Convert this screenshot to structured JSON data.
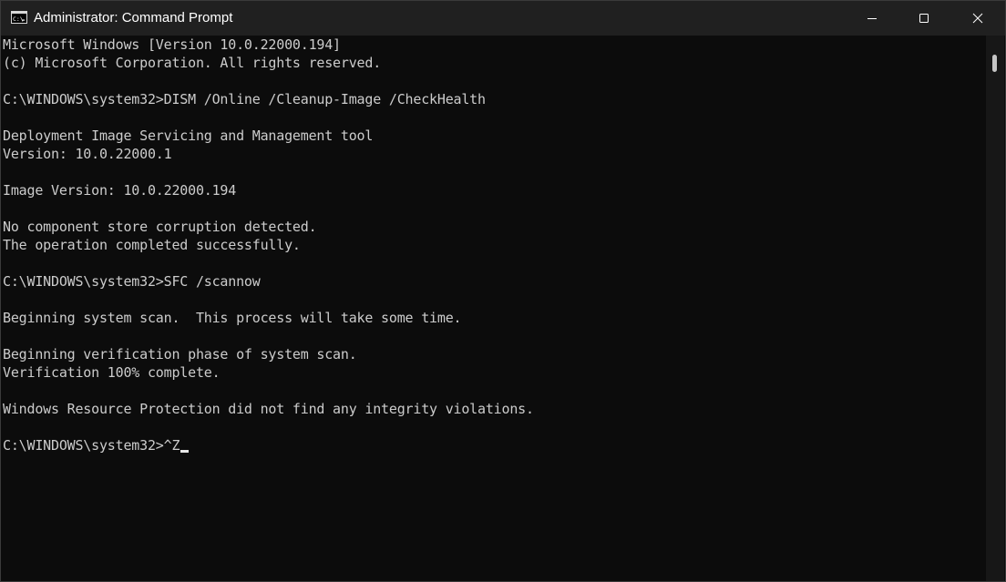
{
  "window": {
    "title": "Administrator: Command Prompt",
    "icon": "cmd-icon",
    "controls": {
      "minimize": "minimize-icon",
      "maximize": "maximize-icon",
      "close": "close-icon"
    }
  },
  "console": {
    "lines": [
      "Microsoft Windows [Version 10.0.22000.194]",
      "(c) Microsoft Corporation. All rights reserved.",
      "",
      "C:\\WINDOWS\\system32>DISM /Online /Cleanup-Image /CheckHealth",
      "",
      "Deployment Image Servicing and Management tool",
      "Version: 10.0.22000.1",
      "",
      "Image Version: 10.0.22000.194",
      "",
      "No component store corruption detected.",
      "The operation completed successfully.",
      "",
      "C:\\WINDOWS\\system32>SFC /scannow",
      "",
      "Beginning system scan.  This process will take some time.",
      "",
      "Beginning verification phase of system scan.",
      "Verification 100% complete.",
      "",
      "Windows Resource Protection did not find any integrity violations.",
      "",
      "C:\\WINDOWS\\system32>^Z"
    ]
  },
  "colors": {
    "titlebar": "#202020",
    "console_bg": "#0c0c0c",
    "console_text": "#cccccc"
  }
}
